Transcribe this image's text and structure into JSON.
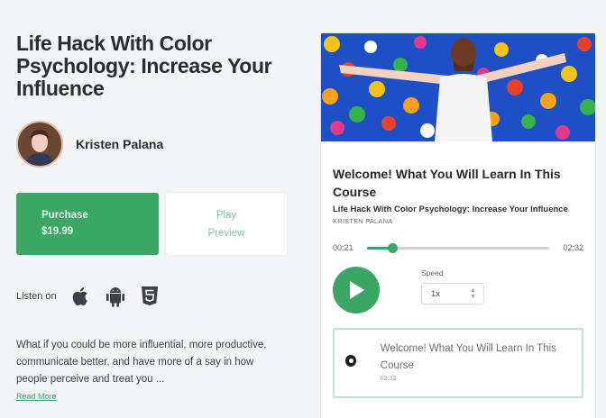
{
  "course": {
    "title": "Life Hack With Color Psychology: Increase Your Influence",
    "author": "Kristen Palana"
  },
  "buttons": {
    "purchase_label": "Purchase",
    "purchase_price": "$19.99",
    "preview_line1": "Play",
    "preview_line2": "Preview"
  },
  "listen": {
    "label": "Listen on",
    "platforms": [
      "apple-icon",
      "android-icon",
      "html5-icon"
    ]
  },
  "description": {
    "text": "What if you could be more influential, more productive, communicate better, and have more of a say in how people perceive and treat you ...",
    "read_more": "Read More"
  },
  "player": {
    "episode_title": "Welcome! What You Will Learn In This Course",
    "course_title": "Life Hack With Color Psychology: Increase Your Influence",
    "author_caps": "KRISTEN PALANA",
    "current_time": "00:21",
    "total_time": "02:32",
    "progress_fraction": 0.138,
    "speed_label": "Speed",
    "speed_value": "1x"
  },
  "episodes": [
    {
      "name": "Welcome! What You Will Learn In This Course",
      "duration": "02:32"
    }
  ],
  "colors": {
    "accent": "#3aa764",
    "hero_sky": "#1f4fc4"
  }
}
